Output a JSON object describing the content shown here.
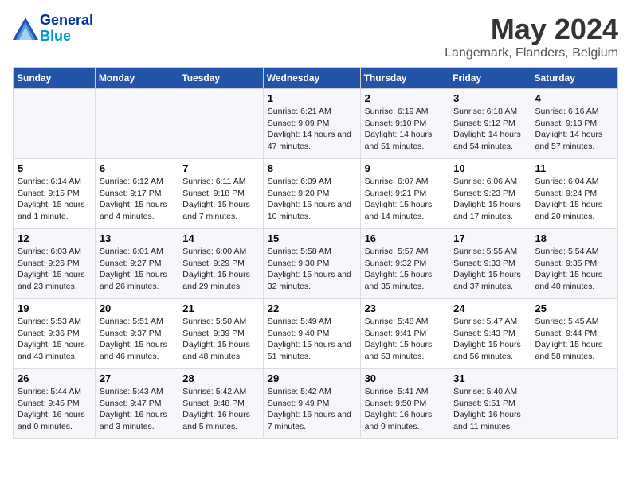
{
  "header": {
    "logo_line1": "General",
    "logo_line2": "Blue",
    "month_year": "May 2024",
    "location": "Langemark, Flanders, Belgium"
  },
  "weekdays": [
    "Sunday",
    "Monday",
    "Tuesday",
    "Wednesday",
    "Thursday",
    "Friday",
    "Saturday"
  ],
  "weeks": [
    [
      {
        "day": "",
        "content": ""
      },
      {
        "day": "",
        "content": ""
      },
      {
        "day": "",
        "content": ""
      },
      {
        "day": "1",
        "content": "Sunrise: 6:21 AM\nSunset: 9:09 PM\nDaylight: 14 hours and 47 minutes."
      },
      {
        "day": "2",
        "content": "Sunrise: 6:19 AM\nSunset: 9:10 PM\nDaylight: 14 hours and 51 minutes."
      },
      {
        "day": "3",
        "content": "Sunrise: 6:18 AM\nSunset: 9:12 PM\nDaylight: 14 hours and 54 minutes."
      },
      {
        "day": "4",
        "content": "Sunrise: 6:16 AM\nSunset: 9:13 PM\nDaylight: 14 hours and 57 minutes."
      }
    ],
    [
      {
        "day": "5",
        "content": "Sunrise: 6:14 AM\nSunset: 9:15 PM\nDaylight: 15 hours and 1 minute."
      },
      {
        "day": "6",
        "content": "Sunrise: 6:12 AM\nSunset: 9:17 PM\nDaylight: 15 hours and 4 minutes."
      },
      {
        "day": "7",
        "content": "Sunrise: 6:11 AM\nSunset: 9:18 PM\nDaylight: 15 hours and 7 minutes."
      },
      {
        "day": "8",
        "content": "Sunrise: 6:09 AM\nSunset: 9:20 PM\nDaylight: 15 hours and 10 minutes."
      },
      {
        "day": "9",
        "content": "Sunrise: 6:07 AM\nSunset: 9:21 PM\nDaylight: 15 hours and 14 minutes."
      },
      {
        "day": "10",
        "content": "Sunrise: 6:06 AM\nSunset: 9:23 PM\nDaylight: 15 hours and 17 minutes."
      },
      {
        "day": "11",
        "content": "Sunrise: 6:04 AM\nSunset: 9:24 PM\nDaylight: 15 hours and 20 minutes."
      }
    ],
    [
      {
        "day": "12",
        "content": "Sunrise: 6:03 AM\nSunset: 9:26 PM\nDaylight: 15 hours and 23 minutes."
      },
      {
        "day": "13",
        "content": "Sunrise: 6:01 AM\nSunset: 9:27 PM\nDaylight: 15 hours and 26 minutes."
      },
      {
        "day": "14",
        "content": "Sunrise: 6:00 AM\nSunset: 9:29 PM\nDaylight: 15 hours and 29 minutes."
      },
      {
        "day": "15",
        "content": "Sunrise: 5:58 AM\nSunset: 9:30 PM\nDaylight: 15 hours and 32 minutes."
      },
      {
        "day": "16",
        "content": "Sunrise: 5:57 AM\nSunset: 9:32 PM\nDaylight: 15 hours and 35 minutes."
      },
      {
        "day": "17",
        "content": "Sunrise: 5:55 AM\nSunset: 9:33 PM\nDaylight: 15 hours and 37 minutes."
      },
      {
        "day": "18",
        "content": "Sunrise: 5:54 AM\nSunset: 9:35 PM\nDaylight: 15 hours and 40 minutes."
      }
    ],
    [
      {
        "day": "19",
        "content": "Sunrise: 5:53 AM\nSunset: 9:36 PM\nDaylight: 15 hours and 43 minutes."
      },
      {
        "day": "20",
        "content": "Sunrise: 5:51 AM\nSunset: 9:37 PM\nDaylight: 15 hours and 46 minutes."
      },
      {
        "day": "21",
        "content": "Sunrise: 5:50 AM\nSunset: 9:39 PM\nDaylight: 15 hours and 48 minutes."
      },
      {
        "day": "22",
        "content": "Sunrise: 5:49 AM\nSunset: 9:40 PM\nDaylight: 15 hours and 51 minutes."
      },
      {
        "day": "23",
        "content": "Sunrise: 5:48 AM\nSunset: 9:41 PM\nDaylight: 15 hours and 53 minutes."
      },
      {
        "day": "24",
        "content": "Sunrise: 5:47 AM\nSunset: 9:43 PM\nDaylight: 15 hours and 56 minutes."
      },
      {
        "day": "25",
        "content": "Sunrise: 5:45 AM\nSunset: 9:44 PM\nDaylight: 15 hours and 58 minutes."
      }
    ],
    [
      {
        "day": "26",
        "content": "Sunrise: 5:44 AM\nSunset: 9:45 PM\nDaylight: 16 hours and 0 minutes."
      },
      {
        "day": "27",
        "content": "Sunrise: 5:43 AM\nSunset: 9:47 PM\nDaylight: 16 hours and 3 minutes."
      },
      {
        "day": "28",
        "content": "Sunrise: 5:42 AM\nSunset: 9:48 PM\nDaylight: 16 hours and 5 minutes."
      },
      {
        "day": "29",
        "content": "Sunrise: 5:42 AM\nSunset: 9:49 PM\nDaylight: 16 hours and 7 minutes."
      },
      {
        "day": "30",
        "content": "Sunrise: 5:41 AM\nSunset: 9:50 PM\nDaylight: 16 hours and 9 minutes."
      },
      {
        "day": "31",
        "content": "Sunrise: 5:40 AM\nSunset: 9:51 PM\nDaylight: 16 hours and 11 minutes."
      },
      {
        "day": "",
        "content": ""
      }
    ]
  ]
}
